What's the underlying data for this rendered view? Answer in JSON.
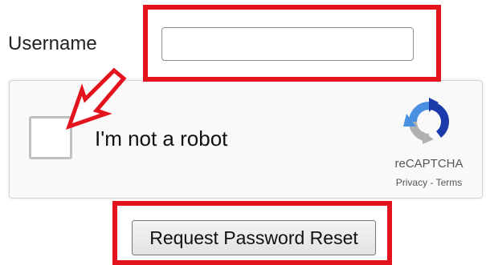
{
  "form": {
    "username_label": "Username",
    "username_value": "",
    "submit_label": "Request Password Reset"
  },
  "recaptcha": {
    "checkbox_label": "I'm not a robot",
    "checked": false,
    "brand": "reCAPTCHA",
    "privacy_link": "Privacy",
    "separator": " - ",
    "terms_link": "Terms",
    "logo_icon": "recaptcha-logo-icon"
  },
  "annotations": {
    "color": "#e3141d",
    "highlight_icon": "red-highlight-box",
    "arrow_icon": "red-arrow-icon"
  },
  "colors": {
    "recaptcha_blue": "#1c3aa9",
    "recaptcha_light_blue": "#4a90e2",
    "recaptcha_gray": "#b1b1b1"
  }
}
